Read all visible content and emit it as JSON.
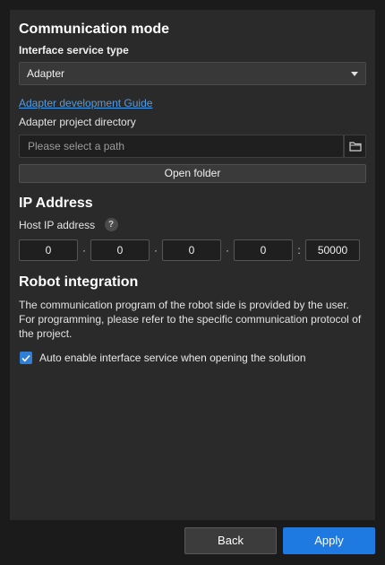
{
  "communication": {
    "title": "Communication mode",
    "interface_label": "Interface service type",
    "interface_value": "Adapter",
    "guide_link": "Adapter development Guide",
    "dir_label": "Adapter project directory",
    "path_placeholder": "Please select a path",
    "open_folder": "Open folder"
  },
  "ip": {
    "title": "IP Address",
    "host_label": "Host IP address",
    "help_glyph": "?",
    "octets": [
      "0",
      "0",
      "0",
      "0"
    ],
    "dot": "·",
    "colon": ":",
    "port": "50000"
  },
  "robot": {
    "title": "Robot integration",
    "description": "The communication program of the robot side is provided by the user. For programming, please refer to the specific communication protocol of the project.",
    "auto_enable_label": "Auto enable interface service when opening the solution",
    "auto_enable_checked": true
  },
  "footer": {
    "back": "Back",
    "apply": "Apply"
  },
  "colors": {
    "accent": "#1e7ae0",
    "link": "#4d9ee8",
    "panel": "#2a2a2a",
    "background": "#1b1b1b"
  },
  "icons": [
    "chevron-down-icon",
    "folder-icon",
    "help-icon",
    "check-icon"
  ]
}
